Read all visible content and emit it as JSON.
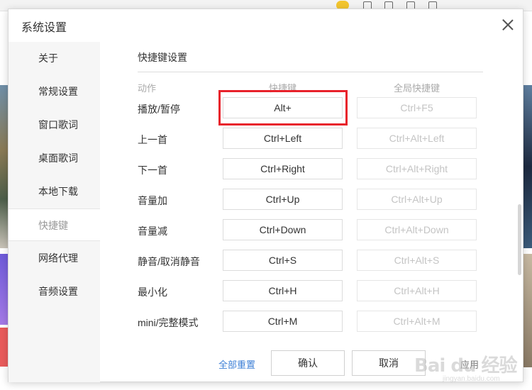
{
  "dialog": {
    "title": "系统设置",
    "close_icon": "close-icon"
  },
  "sidebar": {
    "items": [
      {
        "label": "关于",
        "active": false
      },
      {
        "label": "常规设置",
        "active": false
      },
      {
        "label": "窗口歌词",
        "active": false
      },
      {
        "label": "桌面歌词",
        "active": false
      },
      {
        "label": "本地下载",
        "active": false
      },
      {
        "label": "快捷键",
        "active": true
      },
      {
        "label": "网络代理",
        "active": false
      },
      {
        "label": "音频设置",
        "active": false
      }
    ]
  },
  "section": {
    "title": "快捷键设置",
    "headers": {
      "action": "动作",
      "shortcut": "快捷键",
      "global": "全局快捷键"
    }
  },
  "rows": [
    {
      "action": "播放/暂停",
      "shortcut": "Alt+",
      "global": "Ctrl+F5"
    },
    {
      "action": "上一首",
      "shortcut": "Ctrl+Left",
      "global": "Ctrl+Alt+Left"
    },
    {
      "action": "下一首",
      "shortcut": "Ctrl+Right",
      "global": "Ctrl+Alt+Right"
    },
    {
      "action": "音量加",
      "shortcut": "Ctrl+Up",
      "global": "Ctrl+Alt+Up"
    },
    {
      "action": "音量减",
      "shortcut": "Ctrl+Down",
      "global": "Ctrl+Alt+Down"
    },
    {
      "action": "静音/取消静音",
      "shortcut": "Ctrl+S",
      "global": "Ctrl+Alt+S"
    },
    {
      "action": "最小化",
      "shortcut": "Ctrl+H",
      "global": "Ctrl+Alt+H"
    },
    {
      "action": "mini/完整模式",
      "shortcut": "Ctrl+M",
      "global": "Ctrl+Alt+M"
    }
  ],
  "footer": {
    "reset_all": "全部重置",
    "confirm": "确认",
    "cancel": "取消",
    "apply": "应用"
  },
  "watermark": {
    "main": "Bai du 经验",
    "sub": "jingyan.baidu.com"
  },
  "colors": {
    "highlight": "#e8222b",
    "link": "#3d7fd6"
  }
}
